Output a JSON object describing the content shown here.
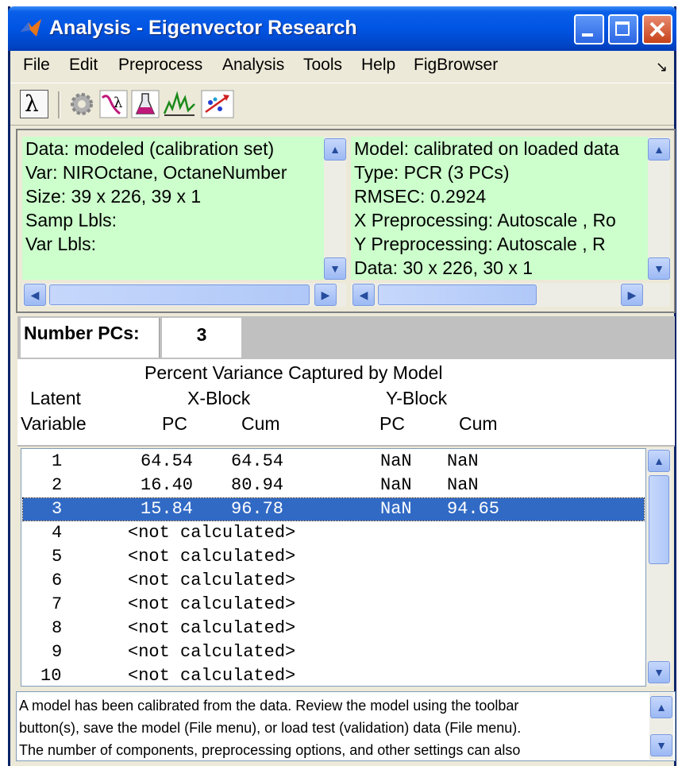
{
  "window": {
    "title": "Analysis - Eigenvector Research"
  },
  "menu": {
    "items": [
      "File",
      "Edit",
      "Preprocess",
      "Analysis",
      "Tools",
      "Help",
      "FigBrowser"
    ]
  },
  "toolbar": {
    "icons": [
      "lambda-icon",
      "gear-icon",
      "wavy-lambda-icon",
      "flask-icon",
      "spectra-icon",
      "scatter-arrow-icon"
    ]
  },
  "data_panel": {
    "lines": [
      "Data: modeled (calibration set)",
      "Var: NIROctane, OctaneNumber",
      "Size: 39 x 226, 39 x 1",
      "Samp Lbls:",
      "Var Lbls:"
    ]
  },
  "model_panel": {
    "lines": [
      "Model: calibrated on loaded data",
      "Type: PCR (3 PCs)",
      "RMSEC: 0.2924",
      "X Preprocessing: Autoscale , Ro",
      "Y Preprocessing: Autoscale , R",
      "Data: 30 x 226, 30 x 1"
    ]
  },
  "pcs": {
    "label": "Number PCs:",
    "value": "3"
  },
  "variance": {
    "title": "Percent Variance Captured by Model",
    "col_latent": "Latent",
    "col_variable": "Variable",
    "col_xblock": "X-Block",
    "col_yblock": "Y-Block",
    "col_pc": "PC",
    "col_cum": "Cum",
    "rows": [
      {
        "n": "1",
        "xpc": "64.54",
        "xcum": "64.54",
        "ypc": "NaN",
        "ycum": "NaN"
      },
      {
        "n": "2",
        "xpc": "16.40",
        "xcum": "80.94",
        "ypc": "NaN",
        "ycum": "NaN"
      },
      {
        "n": "3",
        "xpc": "15.84",
        "xcum": "96.78",
        "ypc": "NaN",
        "ycum": "94.65"
      },
      {
        "n": "4",
        "note": "<not calculated>"
      },
      {
        "n": "5",
        "note": "<not calculated>"
      },
      {
        "n": "6",
        "note": "<not calculated>"
      },
      {
        "n": "7",
        "note": "<not calculated>"
      },
      {
        "n": "8",
        "note": "<not calculated>"
      },
      {
        "n": "9",
        "note": "<not calculated>"
      },
      {
        "n": "10",
        "note": "<not calculated>"
      }
    ],
    "selected_row": 2
  },
  "status": {
    "lines": [
      "A model has been calibrated from the data. Review the model using the toolbar",
      "button(s), save the model (File menu), or load test (validation) data (File menu).",
      "The number of components, preprocessing options, and other settings can also"
    ]
  },
  "colors": {
    "panel_green": "#ccffcc",
    "selection": "#316ac5",
    "titlebar": "#0054e3"
  }
}
